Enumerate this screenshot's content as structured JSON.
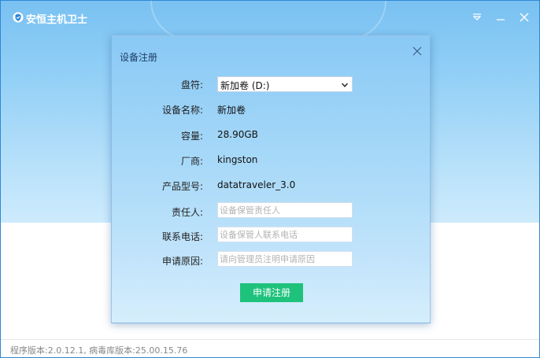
{
  "app": {
    "title": "安恒主机卫士"
  },
  "footer": {
    "version_text": "程序版本:2.0.12.1, 病毒库版本:25.00.15.76"
  },
  "dialog": {
    "title": "设备注册",
    "fields": {
      "drive_label": "盘符:",
      "drive_value": "新加卷 (D:)",
      "name_label": "设备名称:",
      "name_value": "新加卷",
      "capacity_label": "容量:",
      "capacity_value": "28.90GB",
      "vendor_label": "厂商:",
      "vendor_value": "kingston",
      "model_label": "产品型号:",
      "model_value": "datatraveler_3.0",
      "owner_label": "责任人:",
      "owner_placeholder": "设备保管责任人",
      "phone_label": "联系电话:",
      "phone_placeholder": "设备保管人联系电话",
      "reason_label": "申请原因:",
      "reason_placeholder": "请向管理员注明申请原因"
    },
    "submit_label": "申请注册"
  },
  "icons": {
    "logo": "shield-logo-icon",
    "menu": "menu-triangle-icon",
    "minimize": "minimize-icon",
    "close": "close-icon",
    "dialog_close": "close-icon",
    "dropdown": "chevron-down-icon"
  },
  "colors": {
    "accent_green": "#1ec27b",
    "title_blue": "#79c1f2"
  }
}
